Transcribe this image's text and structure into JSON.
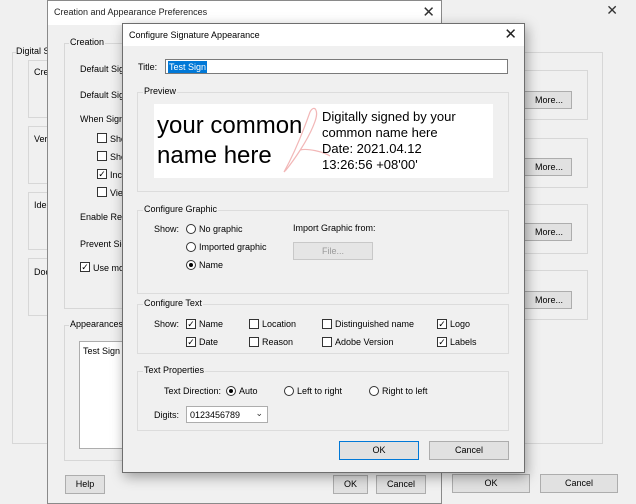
{
  "background_window": {
    "digital_label": "Digital S",
    "group_items": [
      "Crea",
      "Veri",
      "Ide",
      "Doc"
    ],
    "more_buttons": [
      "More...",
      "More...",
      "More...",
      "More..."
    ],
    "ok_label": "OK",
    "cancel_label": "Cancel"
  },
  "creation_dialog": {
    "title": "Creation and Appearance Preferences",
    "creation_group": "Creation",
    "rows": [
      "Default Sig",
      "Default Sig",
      "When Sign",
      "Enable Rev",
      "Prevent Sig"
    ],
    "checkboxes": [
      {
        "label": "Sho",
        "checked": false
      },
      {
        "label": "Sho",
        "checked": false
      },
      {
        "label": "Incl",
        "checked": true
      },
      {
        "label": "Viev",
        "checked": false
      }
    ],
    "use_mo": {
      "label": "Use mo",
      "checked": true
    },
    "appearances_group": "Appearances",
    "appearances_item": "Test Sign",
    "help_label": "Help",
    "ok_label": "OK",
    "cancel_label": "Cancel"
  },
  "sig_dialog": {
    "title": "Configure Signature Appearance",
    "title_label": "Title:",
    "title_value": "Test Sign",
    "preview_group": "Preview",
    "preview": {
      "name": "your common name here",
      "details": [
        "Digitally signed by your",
        "common name here",
        "Date: 2021.04.12",
        "13:26:56 +08'00'"
      ]
    },
    "graphic_group": "Configure Graphic",
    "show_label": "Show:",
    "graphic_options": [
      {
        "label": "No graphic",
        "selected": false
      },
      {
        "label": "Imported graphic",
        "selected": false
      },
      {
        "label": "Name",
        "selected": true
      }
    ],
    "import_label": "Import Graphic from:",
    "file_button": "File...",
    "text_group": "Configure Text",
    "text_show_label": "Show:",
    "text_options": [
      {
        "label": "Name",
        "checked": true
      },
      {
        "label": "Location",
        "checked": false
      },
      {
        "label": "Distinguished name",
        "checked": false
      },
      {
        "label": "Logo",
        "checked": true
      },
      {
        "label": "Date",
        "checked": true
      },
      {
        "label": "Reason",
        "checked": false
      },
      {
        "label": "Adobe Version",
        "checked": false
      },
      {
        "label": "Labels",
        "checked": true
      }
    ],
    "text_props_group": "Text Properties",
    "direction_label": "Text Direction:",
    "direction_options": [
      {
        "label": "Auto",
        "selected": true
      },
      {
        "label": "Left to right",
        "selected": false
      },
      {
        "label": "Right to left",
        "selected": false
      }
    ],
    "digits_label": "Digits:",
    "digits_value": "0123456789",
    "ok_label": "OK",
    "cancel_label": "Cancel"
  },
  "colors": {
    "accent": "#0078d7",
    "dialog_bg": "#f0f0f0",
    "button_bg": "#e1e1e1"
  }
}
